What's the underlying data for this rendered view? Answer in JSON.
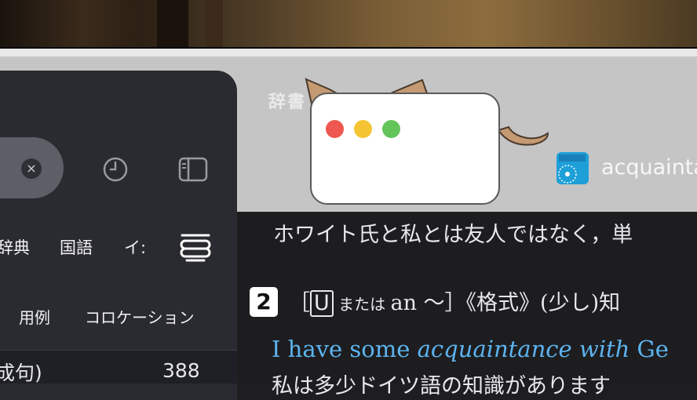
{
  "header": {
    "title": "辞書",
    "dictionary_name": "acquainta"
  },
  "sidebar": {
    "clear_icon": "×",
    "tabs": [
      "辞典",
      "国語",
      "イ:"
    ],
    "subtabs": [
      "用例",
      "コロケーション"
    ],
    "list": {
      "label": "成句)",
      "count": "388"
    }
  },
  "entry": {
    "line1": "ホワイト氏と私とは友人ではなく，単",
    "sense_number": "2",
    "sense_open": "［",
    "sense_u": "U",
    "sense_or": " または ",
    "sense_an": "an 〜］《格式》(少し)知",
    "example_plain": "I have some ",
    "example_italic": "acquaintance with",
    "example_rest": " Ge",
    "translation": "私は多少ドイツ語の知識があります"
  },
  "colors": {
    "sidebar": "#2a2b31",
    "content": "#1d1d1f",
    "example": "#5cb4f0",
    "red": "#ee5850",
    "yellow": "#f4c432",
    "green": "#63c45a"
  },
  "icons": [
    "clear-icon",
    "history-icon",
    "sidebar-toggle-icon",
    "stack-icon",
    "dictionary-brand-icon"
  ]
}
